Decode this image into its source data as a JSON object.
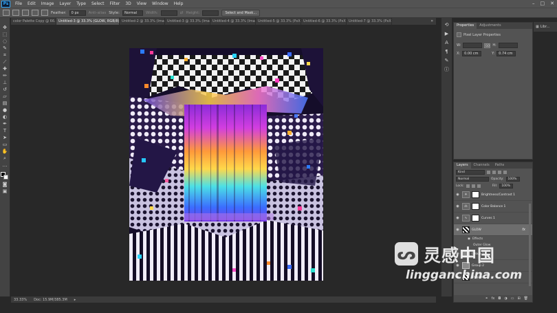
{
  "app": {
    "logo_text": "Ps"
  },
  "menu": [
    "File",
    "Edit",
    "Image",
    "Layer",
    "Type",
    "Select",
    "Filter",
    "3D",
    "View",
    "Window",
    "Help"
  ],
  "options_bar": {
    "feather_label": "Feather:",
    "feather_value": "0 px",
    "antialias_label": "Anti-alias",
    "style_label": "Style:",
    "style_value": "Normal",
    "width_label": "Width:",
    "height_label": "Height:",
    "select_mask_button": "Select and Mask..."
  },
  "tabs": [
    {
      "label": "color Palette Copy @ 66...",
      "active": false
    },
    {
      "label": "Untitled-3 @ 33.3% (GLOW, RGB/8) *",
      "active": true
    },
    {
      "label": "Untitled-2 @ 33.3% (Ima...",
      "active": false
    },
    {
      "label": "Untitled-3 @ 33.3% (Ima...",
      "active": false
    },
    {
      "label": "Untitled-4 @ 33.3% (Ima...",
      "active": false
    },
    {
      "label": "Untitled-5 @ 33.3% (PxX...",
      "active": false
    },
    {
      "label": "Untitled-6 @ 33.3% (PxX...",
      "active": false
    },
    {
      "label": "Untitled-7 @ 33.3% (PxX...",
      "active": false
    }
  ],
  "status": {
    "zoom": "33.33%",
    "doc": "Doc: 15.9M/385.3M"
  },
  "properties": {
    "tab_properties": "Properties",
    "tab_adjustments": "Adjustments",
    "title": "Pixel Layer Properties",
    "w_label": "W:",
    "h_label": "H:",
    "x_label": "X:",
    "y_label": "Y:",
    "x_value": "0.00 cm",
    "y_value": "0.74 cm",
    "go_label": "GO"
  },
  "library": {
    "label": "Libr..."
  },
  "layers_panel": {
    "tab_layers": "Layers",
    "tab_channels": "Channels",
    "tab_paths": "Paths",
    "kind_label": "Kind",
    "blend_mode": "Normal",
    "opacity_label": "Opacity:",
    "opacity_value": "100%",
    "lock_label": "Lock:",
    "fill_label": "Fill:",
    "fill_value": "100%",
    "effects_label": "Effects",
    "outer_glow_label": "Outer Glow",
    "layers": [
      {
        "name": "Brightness/Contrast 1",
        "kind": "adjustment",
        "icon": "☀"
      },
      {
        "name": "Color Balance 1",
        "kind": "adjustment",
        "icon": "⚖"
      },
      {
        "name": "Curves 1",
        "kind": "adjustment",
        "icon": "∿"
      },
      {
        "name": "GLOW",
        "kind": "pattern",
        "selected": true,
        "fx": "fx"
      },
      {
        "name": "Group 1",
        "kind": "folder"
      },
      {
        "name": "Group 2",
        "kind": "folder"
      },
      {
        "name": "shapes",
        "kind": "pattern"
      }
    ]
  },
  "watermark": {
    "cn": "灵感中国",
    "url": "lingganchina.com"
  },
  "colors": {
    "app_bg": "#282828",
    "panel_bg": "#535353",
    "accent": "#31a8ff"
  },
  "icons": {
    "tools": [
      "move-icon",
      "marquee-icon",
      "lasso-icon",
      "quick-select-icon",
      "crop-icon",
      "eyedropper-icon",
      "healing-icon",
      "brush-icon",
      "stamp-icon",
      "history-brush-icon",
      "eraser-icon",
      "gradient-icon",
      "blur-icon",
      "dodge-icon",
      "pen-icon",
      "type-icon",
      "path-select-icon",
      "shape-icon",
      "hand-icon",
      "zoom-icon"
    ]
  }
}
